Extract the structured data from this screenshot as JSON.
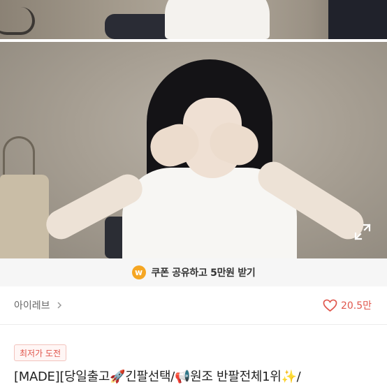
{
  "coupon": {
    "icon_letter": "w",
    "text": "쿠폰 공유하고 5만원 받기",
    "accent": "#f5a623"
  },
  "seller": {
    "name": "아이레브",
    "chevron_icon": "chevron-right-icon"
  },
  "likes": {
    "count": "20.5만",
    "icon": "heart-outline-icon",
    "color": "#e0564c"
  },
  "badge": {
    "label": "최저가 도전"
  },
  "product": {
    "title": "[MADE][당일출고🚀긴팔선택/📢원조 반팔전체1위✨/"
  },
  "photo": {
    "expand_icon": "expand-fullscreen-icon"
  }
}
